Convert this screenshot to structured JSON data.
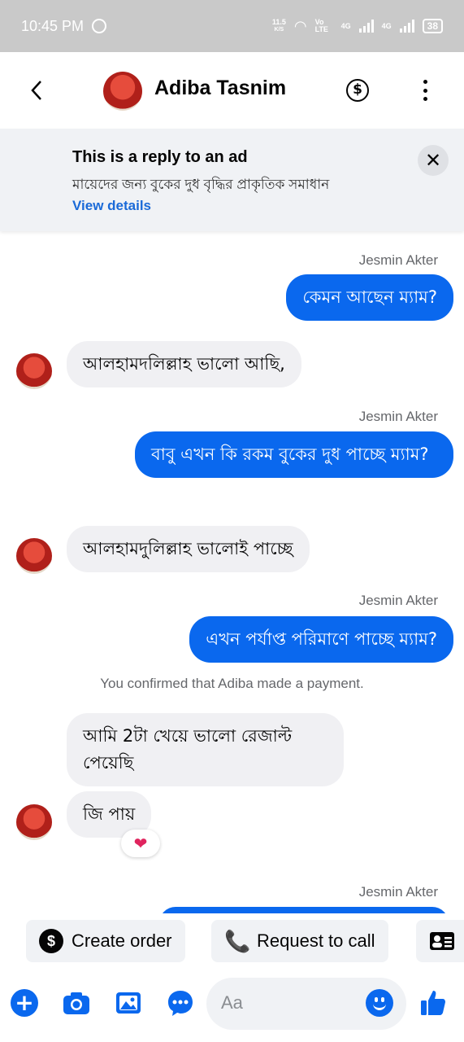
{
  "status_bar": {
    "time": "10:45 PM",
    "speed_value": "11.5",
    "speed_unit": "K/S",
    "volte": "Vo LTE",
    "net1": "4G",
    "net2": "4G",
    "battery": "38"
  },
  "header": {
    "contact_name": "Adiba Tasnim",
    "icons": [
      "back-icon",
      "dollar-icon",
      "more-vertical-icon"
    ]
  },
  "ad_banner": {
    "title": "This is a reply to an ad",
    "text": "মায়েদের জন্য বুকের দুধ বৃদ্ধির প্রাকৃতিক সমাধান",
    "link": "View details"
  },
  "messages": [
    {
      "from": "me",
      "sender": "Jesmin Akter",
      "text": "কেমন আছেন ম্যাম?"
    },
    {
      "from": "contact",
      "text": "আলহামদলিল্লাহ ভালো আছি,"
    },
    {
      "from": "me",
      "sender": "Jesmin Akter",
      "text": "বাবু এখন কি রকম বুকের দুধ পাচ্ছে ম্যাম?"
    },
    {
      "from": "contact",
      "text": "আলহামদুলিল্লাহ ভালোই পাচ্ছে"
    },
    {
      "from": "me",
      "sender": "Jesmin Akter",
      "text": "এখন পর্যাপ্ত পরিমাণে পাচ্ছে ম্যাম?"
    },
    {
      "from": "system",
      "text": "You confirmed that Adiba made a payment."
    },
    {
      "from": "contact",
      "text": "আমি 2টা খেয়ে ভালো রেজাল্ট পেয়েছি"
    },
    {
      "from": "contact",
      "text": "জি পায়",
      "reaction": "❤"
    },
    {
      "from": "me",
      "sender": "Jesmin Akter",
      "text": ""
    }
  ],
  "quick_actions": [
    {
      "label": "Create order",
      "icon": "dollar-circle-icon"
    },
    {
      "label": "Request to call",
      "icon": "phone-plus-icon"
    },
    {
      "label": "",
      "icon": "contact-card-icon"
    }
  ],
  "composer": {
    "placeholder": "Aa",
    "icons": [
      "plus-icon",
      "camera-icon",
      "gallery-icon",
      "chat-bubble-icon",
      "emoji-icon",
      "thumbs-up-icon"
    ]
  },
  "colors": {
    "accent": "#0a68ee",
    "incoming_bubble": "#f0f0f3",
    "status_bar": "#c9c9c9",
    "banner_bg": "#f0f2f5"
  }
}
